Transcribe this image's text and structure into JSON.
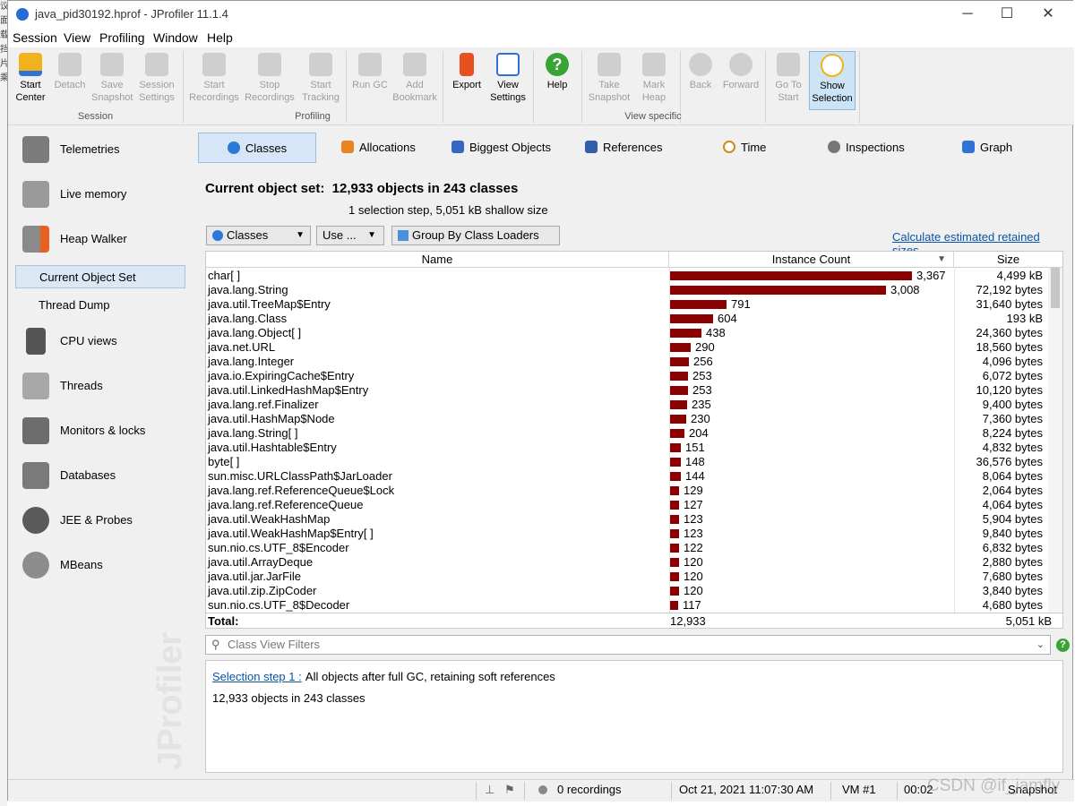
{
  "window": {
    "title": "java_pid30192.hprof - JProfiler 11.1.4",
    "controls": {
      "minimize": "─",
      "maximize": "☐",
      "close": "✕"
    }
  },
  "menubar": [
    "Session",
    "View",
    "Profiling",
    "Window",
    "Help"
  ],
  "toolbar": {
    "buttons": [
      {
        "line1": "Start",
        "line2": "Center",
        "icon": "start-center-icon",
        "enabled": true
      },
      {
        "line1": "Detach",
        "line2": "",
        "icon": "detach-icon",
        "enabled": false
      },
      {
        "line1": "Save",
        "line2": "Snapshot",
        "icon": "save-snapshot-icon",
        "enabled": false
      },
      {
        "line1": "Session",
        "line2": "Settings",
        "icon": "session-settings-icon",
        "enabled": false
      },
      {
        "line1": "Start",
        "line2": "Recordings",
        "icon": "start-recordings-icon",
        "enabled": false
      },
      {
        "line1": "Stop",
        "line2": "Recordings",
        "icon": "stop-recordings-icon",
        "enabled": false
      },
      {
        "line1": "Start",
        "line2": "Tracking",
        "icon": "start-tracking-icon",
        "enabled": false
      },
      {
        "line1": "Run GC",
        "line2": "",
        "icon": "run-gc-icon",
        "enabled": false
      },
      {
        "line1": "Add",
        "line2": "Bookmark",
        "icon": "add-bookmark-icon",
        "enabled": false
      },
      {
        "line1": "Export",
        "line2": "",
        "icon": "export-icon",
        "enabled": true
      },
      {
        "line1": "View",
        "line2": "Settings",
        "icon": "view-settings-icon",
        "enabled": true
      },
      {
        "line1": "Help",
        "line2": "",
        "icon": "help-icon",
        "enabled": true
      },
      {
        "line1": "Take",
        "line2": "Snapshot",
        "icon": "take-snapshot-icon",
        "enabled": false
      },
      {
        "line1": "Mark",
        "line2": "Heap",
        "icon": "mark-heap-icon",
        "enabled": false
      },
      {
        "line1": "Back",
        "line2": "",
        "icon": "back-icon",
        "enabled": false
      },
      {
        "line1": "Forward",
        "line2": "",
        "icon": "forward-icon",
        "enabled": false
      },
      {
        "line1": "Go To",
        "line2": "Start",
        "icon": "go-to-start-icon",
        "enabled": false
      },
      {
        "line1": "Show",
        "line2": "Selection",
        "icon": "show-selection-icon",
        "enabled": true,
        "selected": true
      }
    ],
    "groups": [
      "Session",
      "Profiling",
      "View specific"
    ]
  },
  "sidebar": {
    "items": [
      {
        "label": "Telemetries",
        "icon": "telemetries-icon"
      },
      {
        "label": "Live memory",
        "icon": "live-memory-icon"
      },
      {
        "label": "Heap Walker",
        "icon": "heap-walker-icon"
      }
    ],
    "subitems": [
      {
        "label": "Current Object Set",
        "selected": true
      },
      {
        "label": "Thread Dump",
        "selected": false
      }
    ],
    "items2": [
      {
        "label": "CPU views",
        "icon": "cpu-views-icon"
      },
      {
        "label": "Threads",
        "icon": "threads-icon"
      },
      {
        "label": "Monitors & locks",
        "icon": "lock-icon"
      },
      {
        "label": "Databases",
        "icon": "databases-icon"
      },
      {
        "label": "JEE & Probes",
        "icon": "jee-probes-icon"
      },
      {
        "label": "MBeans",
        "icon": "mbeans-icon"
      }
    ],
    "watermark": "JProfiler"
  },
  "view_tabs": [
    {
      "label": "Classes",
      "icon": "classes-icon"
    },
    {
      "label": "Allocations",
      "icon": "allocations-icon"
    },
    {
      "label": "Biggest Objects",
      "icon": "biggest-objects-icon"
    },
    {
      "label": "References",
      "icon": "references-icon"
    },
    {
      "label": "Time",
      "icon": "time-icon"
    },
    {
      "label": "Inspections",
      "icon": "inspections-icon"
    },
    {
      "label": "Graph",
      "icon": "graph-icon"
    }
  ],
  "main": {
    "heading": "Current object set:  12,933 objects in 243 classes",
    "subheading": "1 selection step, 5,051 kB shallow size",
    "classes_dropdown": "Classes",
    "use_button": "Use ...",
    "group_button": "Group By Class Loaders",
    "calc_link": "Calculate estimated retained sizes"
  },
  "table": {
    "columns": [
      "Name",
      "Instance Count",
      "Size"
    ],
    "max_count": 3367,
    "rows": [
      {
        "name": "char[ ]",
        "count": "3,367",
        "count_value": 3367,
        "size": "4,499 kB"
      },
      {
        "name": "java.lang.String",
        "count": "3,008",
        "count_value": 3008,
        "size": "72,192 bytes"
      },
      {
        "name": "java.util.TreeMap$Entry",
        "count": "791",
        "count_value": 791,
        "size": "31,640 bytes"
      },
      {
        "name": "java.lang.Class",
        "count": "604",
        "count_value": 604,
        "size": "193 kB"
      },
      {
        "name": "java.lang.Object[ ]",
        "count": "438",
        "count_value": 438,
        "size": "24,360 bytes"
      },
      {
        "name": "java.net.URL",
        "count": "290",
        "count_value": 290,
        "size": "18,560 bytes"
      },
      {
        "name": "java.lang.Integer",
        "count": "256",
        "count_value": 256,
        "size": "4,096 bytes"
      },
      {
        "name": "java.io.ExpiringCache$Entry",
        "count": "253",
        "count_value": 253,
        "size": "6,072 bytes"
      },
      {
        "name": "java.util.LinkedHashMap$Entry",
        "count": "253",
        "count_value": 253,
        "size": "10,120 bytes"
      },
      {
        "name": "java.lang.ref.Finalizer",
        "count": "235",
        "count_value": 235,
        "size": "9,400 bytes"
      },
      {
        "name": "java.util.HashMap$Node",
        "count": "230",
        "count_value": 230,
        "size": "7,360 bytes"
      },
      {
        "name": "java.lang.String[ ]",
        "count": "204",
        "count_value": 204,
        "size": "8,224 bytes"
      },
      {
        "name": "java.util.Hashtable$Entry",
        "count": "151",
        "count_value": 151,
        "size": "4,832 bytes"
      },
      {
        "name": "byte[ ]",
        "count": "148",
        "count_value": 148,
        "size": "36,576 bytes"
      },
      {
        "name": "sun.misc.URLClassPath$JarLoader",
        "count": "144",
        "count_value": 144,
        "size": "8,064 bytes"
      },
      {
        "name": "java.lang.ref.ReferenceQueue$Lock",
        "count": "129",
        "count_value": 129,
        "size": "2,064 bytes"
      },
      {
        "name": "java.lang.ref.ReferenceQueue",
        "count": "127",
        "count_value": 127,
        "size": "4,064 bytes"
      },
      {
        "name": "java.util.WeakHashMap",
        "count": "123",
        "count_value": 123,
        "size": "5,904 bytes"
      },
      {
        "name": "java.util.WeakHashMap$Entry[ ]",
        "count": "123",
        "count_value": 123,
        "size": "9,840 bytes"
      },
      {
        "name": "sun.nio.cs.UTF_8$Encoder",
        "count": "122",
        "count_value": 122,
        "size": "6,832 bytes"
      },
      {
        "name": "java.util.ArrayDeque",
        "count": "120",
        "count_value": 120,
        "size": "2,880 bytes"
      },
      {
        "name": "java.util.jar.JarFile",
        "count": "120",
        "count_value": 120,
        "size": "7,680 bytes"
      },
      {
        "name": "java.util.zip.ZipCoder",
        "count": "120",
        "count_value": 120,
        "size": "3,840 bytes"
      },
      {
        "name": "sun.nio.cs.UTF_8$Decoder",
        "count": "117",
        "count_value": 117,
        "size": "4,680 bytes"
      }
    ],
    "total": {
      "label": "Total:",
      "count": "12,933",
      "size": "5,051 kB"
    }
  },
  "filter": {
    "placeholder": "Class View Filters"
  },
  "info": {
    "step_link": "Selection step 1 :",
    "step_text": " All objects after full GC, retaining soft references",
    "summary": "12,933 objects in 243 classes"
  },
  "statusbar": {
    "recordings": "0 recordings",
    "datetime": "Oct 21, 2021 11:07:30 AM",
    "vm": "VM #1",
    "elapsed": "00:02",
    "mode": "Snapshot",
    "csdn_watermark": "CSDN @if_iamfly"
  },
  "colors": {
    "bar": "#8b0000",
    "link": "#0a53a8",
    "selected_bg": "#d6e6f6"
  }
}
